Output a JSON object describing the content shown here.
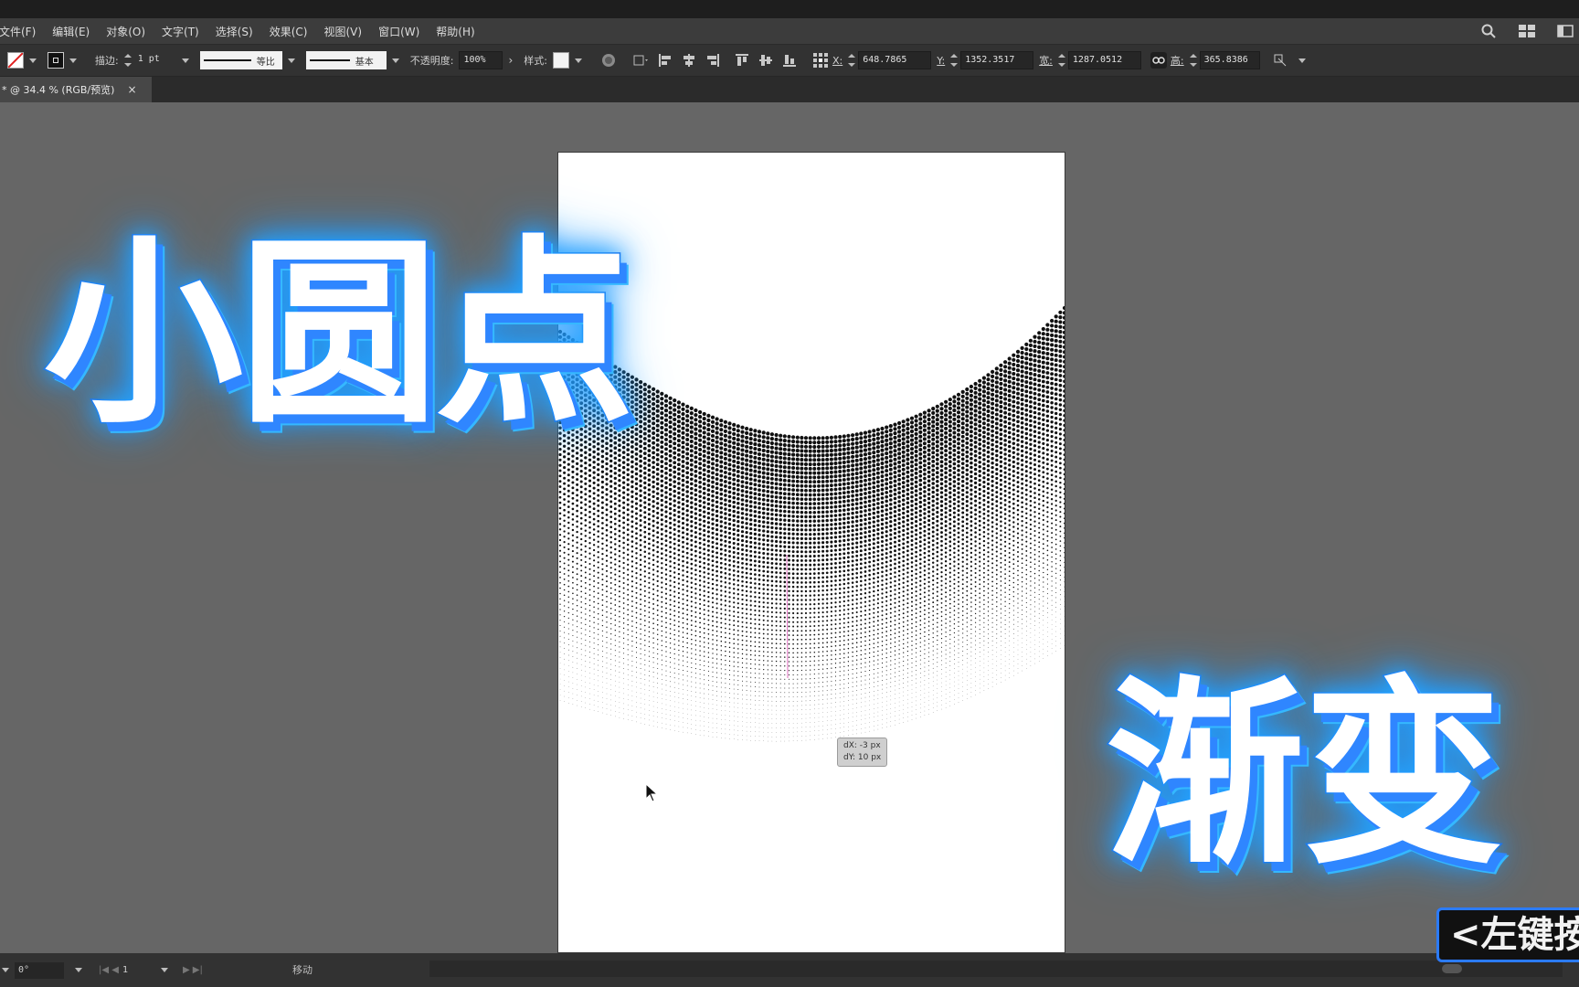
{
  "menubar": {
    "items": [
      "文件(F)",
      "编辑(E)",
      "对象(O)",
      "文字(T)",
      "选择(S)",
      "效果(C)",
      "视图(V)",
      "窗口(W)",
      "帮助(H)"
    ],
    "icons": [
      "search-icon",
      "workspace-icon",
      "panel-icon"
    ]
  },
  "control_bar": {
    "stroke_label": "描边:",
    "stroke_weight": "1 pt",
    "profile_uniform": "等比",
    "brush_basic": "基本",
    "opacity_label": "不透明度:",
    "opacity_value": "100%",
    "style_label": "样式:",
    "x_label": "X:",
    "x_value": "648.7865",
    "y_label": "Y:",
    "y_value": "1352.3517",
    "width_label": "宽:",
    "width_value": "1287.0512",
    "height_label": "高:",
    "height_value": "365.8386"
  },
  "document_tab": {
    "title": "* @ 34.4 % (RGB/预览)",
    "close": "×"
  },
  "canvas": {
    "tooltip_dx": "dX: -3 px",
    "tooltip_dy": "dY: 10 px"
  },
  "overlay": {
    "title_top": "小圆点",
    "title_bottom": "渐变",
    "hint": "<左键按"
  },
  "statusbar": {
    "rotation": "0°",
    "artboard_number": "1",
    "status_text": "移动"
  },
  "colors": {
    "workspace": "#666666",
    "glow": "#25a7ff",
    "title_stroke": "#1e63e6"
  }
}
